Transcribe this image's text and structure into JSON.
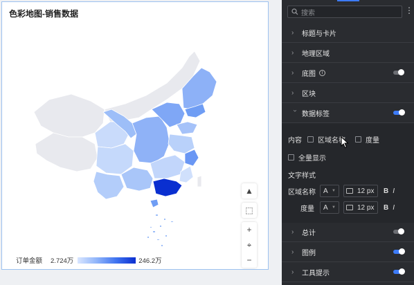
{
  "canvas": {
    "title": "色彩地图-销售数据",
    "legend": {
      "label": "订单金额",
      "min": "2.724万",
      "max": "246.2万"
    },
    "tools": [
      {
        "icon": "warning-icon",
        "glyph": "▲"
      },
      {
        "icon": "select-region-icon",
        "glyph": "⬚"
      },
      {
        "icon": "zoom-in-icon",
        "glyph": "+"
      },
      {
        "icon": "locate-icon",
        "glyph": "⌖"
      },
      {
        "icon": "zoom-out-icon",
        "glyph": "−"
      }
    ]
  },
  "panel": {
    "search_placeholder": "搜索",
    "sections": [
      {
        "label": "标题与卡片",
        "toggle": null
      },
      {
        "label": "地理区域",
        "toggle": null
      },
      {
        "label": "底图",
        "toggle": "off",
        "info": true
      },
      {
        "label": "区块",
        "toggle": null
      },
      {
        "label": "数据标签",
        "toggle": "on",
        "expanded": true
      },
      {
        "label": "总计",
        "toggle": "off"
      },
      {
        "label": "图例",
        "toggle": "on"
      },
      {
        "label": "工具提示",
        "toggle": "on"
      }
    ],
    "data_label": {
      "content_label": "内容",
      "option_region_name": "区域名称",
      "option_measure": "度量",
      "show_all": "全量显示",
      "text_style_label": "文字样式",
      "rows": [
        {
          "label": "区域名称",
          "font": "A",
          "size": "12 px",
          "bold": "B",
          "italic": "I"
        },
        {
          "label": "度量",
          "font": "A",
          "size": "12 px",
          "bold": "B",
          "italic": "I"
        }
      ]
    }
  },
  "colors": {
    "accent": "#3d7bf7",
    "panel_bg": "#2a2c30",
    "map_max": "#0a2fd0",
    "map_min": "#d9e6ff",
    "map_nodata": "#e8e9ee"
  }
}
